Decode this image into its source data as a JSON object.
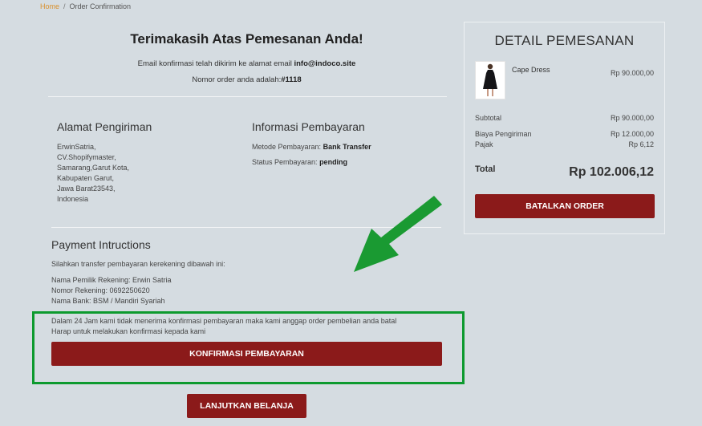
{
  "breadcrumb": {
    "home": "Home",
    "separator": "/",
    "current": "Order Confirmation"
  },
  "confirmation": {
    "title": "Terimakasih Atas Pemesanan Anda!",
    "email_prefix": "Email konfirmasi telah dikirim ke alamat email ",
    "email": "info@indoco.site",
    "order_prefix": "Nomor order anda adalah:",
    "order_number": "#1118"
  },
  "shipping": {
    "heading": "Alamat Pengiriman",
    "lines": [
      "ErwinSatria,",
      "CV.Shopifymaster,",
      "Samarang,Garut Kota,",
      "Kabupaten Garut,",
      "Jawa Barat23543,",
      "Indonesia"
    ]
  },
  "payment_info": {
    "heading": "Informasi Pembayaran",
    "method_label": "Metode Pembayaran:",
    "method_value": "Bank Transfer",
    "status_label": "Status Pembayaran:",
    "status_value": "pending"
  },
  "instructions": {
    "heading": "Payment Intructions",
    "intro": "Silahkan transfer pembayaran kerekening dibawah ini:",
    "account_name": "Nama Pemilik Rekening: Erwin Satria",
    "account_number": "Nomor Rekening: 0692250620",
    "bank": "Nama Bank: BSM / Mandiri Syariah",
    "warning_1": "Dalam 24 Jam kami tidak menerima konfirmasi pembayaran maka kami anggap order pembelian anda batal",
    "warning_2": "Harap untuk  melakukan konfirmasi kepada kami",
    "confirm_button": "KONFIRMASI PEMBAYARAN"
  },
  "continue_button": "LANJUTKAN BELANJA",
  "order_detail": {
    "title": "DETAIL PEMESANAN",
    "item": {
      "name": "Cape Dress",
      "price": "Rp 90.000,00"
    },
    "subtotal_label": "Subtotal",
    "subtotal_value": "Rp 90.000,00",
    "shipping_label": "Biaya Pengiriman",
    "shipping_value": "Rp 12.000,00",
    "tax_label": "Pajak",
    "tax_value": "Rp 6,12",
    "total_label": "Total",
    "total_value": "Rp 102.006,12",
    "cancel_button": "BATALKAN ORDER"
  },
  "colors": {
    "primary": "#8b1a1a",
    "highlight": "#0d9a2e",
    "link": "#d9902c",
    "background": "#d5dce1"
  }
}
